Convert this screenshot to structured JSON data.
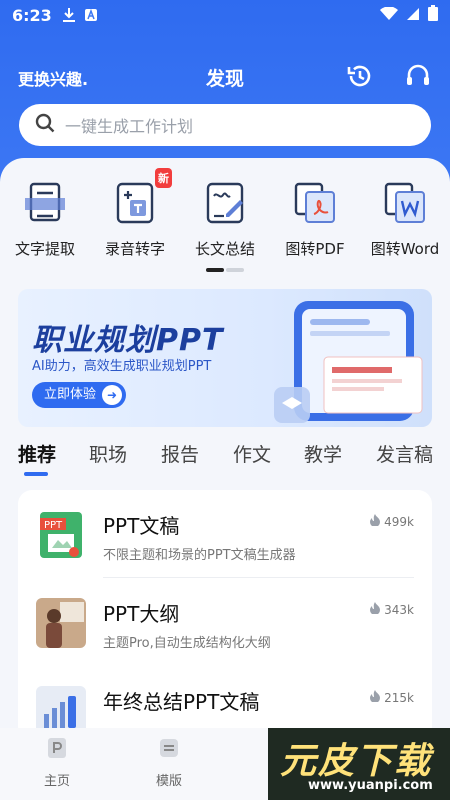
{
  "status_bar": {
    "time": "6:23"
  },
  "header": {
    "interest": "更换兴趣.",
    "title": "发现"
  },
  "search": {
    "placeholder": "一键生成工作计划"
  },
  "tools": [
    {
      "label": "文字提取"
    },
    {
      "label": "录音转字",
      "badge": "新"
    },
    {
      "label": "长文总结"
    },
    {
      "label": "图转PDF"
    },
    {
      "label": "图转Word"
    }
  ],
  "banner": {
    "title": "职业规划PPT",
    "subtitle": "AI助力，高效生成职业规划PPT",
    "button": "立即体验"
  },
  "tabs": [
    {
      "label": "推荐"
    },
    {
      "label": "职场"
    },
    {
      "label": "报告"
    },
    {
      "label": "作文"
    },
    {
      "label": "教学"
    },
    {
      "label": "发言稿"
    }
  ],
  "list": [
    {
      "title": "PPT文稿",
      "desc": "不限主题和场景的PPT文稿生成器",
      "count": "499k",
      "thumb_text": "PPT"
    },
    {
      "title": "PPT大纲",
      "desc": "主题Pro,自动生成结构化大纲",
      "count": "343k"
    },
    {
      "title": "年终总结PPT文稿",
      "desc": "",
      "count": "215k"
    }
  ],
  "bottom_nav": [
    {
      "label": "主页"
    },
    {
      "label": "模版"
    }
  ],
  "watermark": {
    "text": "元皮下载",
    "url": "www.yuanpi.com"
  },
  "colors": {
    "primary": "#2f6bf0",
    "badge": "#f23d3d"
  }
}
